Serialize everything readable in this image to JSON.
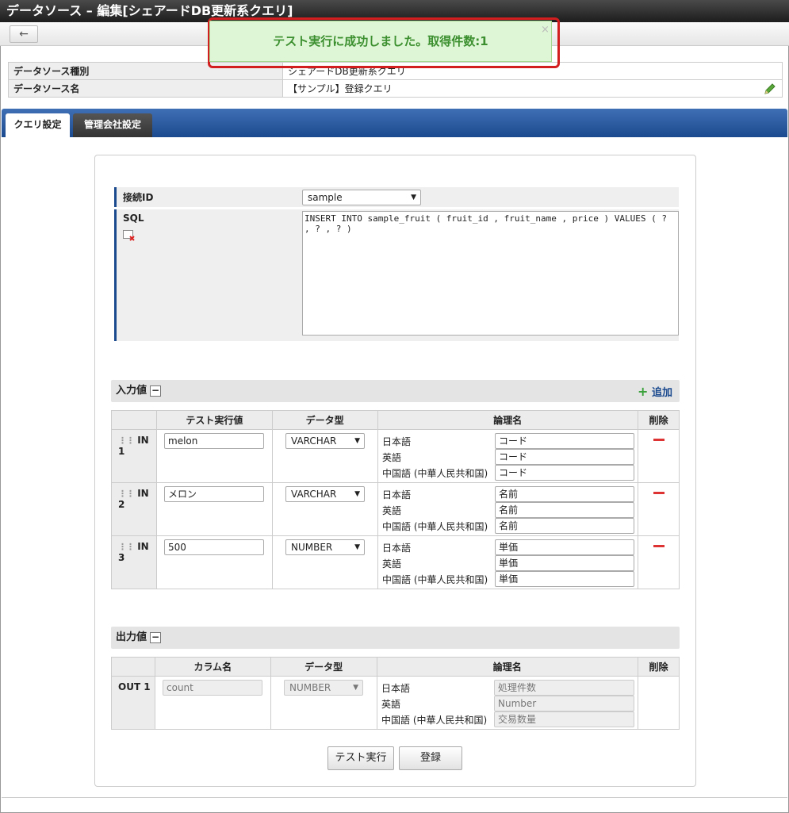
{
  "window": {
    "title": "データソース – 編集[シェアードDB更新系クエリ]"
  },
  "toolbar": {
    "back_icon": "←"
  },
  "toast": {
    "message": "テスト実行に成功しました。取得件数:1",
    "close": "×"
  },
  "info": {
    "type_label": "データソース種別",
    "type_value": "シェアードDB更新系クエリ",
    "name_label": "データソース名",
    "name_value": "【サンプル】登録クエリ"
  },
  "tabs": [
    {
      "label": "クエリ設定"
    },
    {
      "label": "管理会社設定"
    }
  ],
  "query": {
    "conn_label": "接続ID",
    "conn_value": "sample",
    "sql_label": "SQL",
    "sql_text": "INSERT INTO sample_fruit ( fruit_id , fruit_name , price ) VALUES ( ? , ? , ? )"
  },
  "input_section": {
    "title": "入力値",
    "add_label": "追加",
    "headers": [
      "テスト実行値",
      "データ型",
      "論理名",
      "削除"
    ],
    "rows": [
      {
        "id": "IN 1",
        "value": "melon",
        "type": "VARCHAR",
        "names": [
          "コード",
          "コード",
          "コード"
        ]
      },
      {
        "id": "IN 2",
        "value": "メロン",
        "type": "VARCHAR",
        "names": [
          "名前",
          "名前",
          "名前"
        ]
      },
      {
        "id": "IN 3",
        "value": "500",
        "type": "NUMBER",
        "names": [
          "単価",
          "単価",
          "単価"
        ]
      }
    ]
  },
  "langs": [
    "日本語",
    "英語",
    "中国語 (中華人民共和国)"
  ],
  "output_section": {
    "title": "出力値",
    "headers": [
      "カラム名",
      "データ型",
      "論理名",
      "削除"
    ],
    "rows": [
      {
        "id": "OUT 1",
        "value": "count",
        "type": "NUMBER",
        "names": [
          "処理件数",
          "Number",
          "交易数量"
        ]
      }
    ]
  },
  "buttons": {
    "test": "テスト実行",
    "register": "登録"
  }
}
